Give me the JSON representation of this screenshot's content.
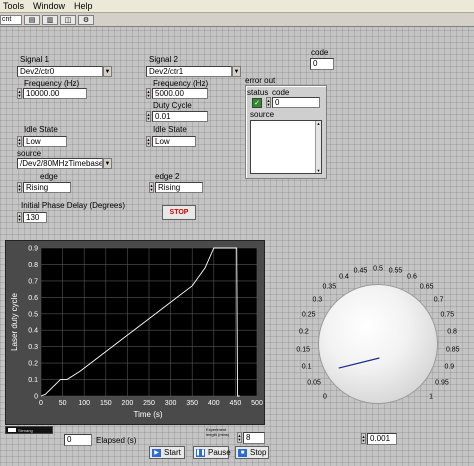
{
  "menu": {
    "items": [
      "Tools",
      "Window",
      "Help"
    ]
  },
  "toolbar": {
    "font_label": "cnt"
  },
  "signal1": {
    "title": "Signal 1",
    "channel": "Dev2/ctr0",
    "frequency_label": "Frequency (Hz)",
    "frequency": "10000.00",
    "idle_state_label": "Idle State",
    "idle_state": "Low",
    "source_label": "source",
    "source": "/Dev2/80MHzTimebase",
    "edge_label": "edge",
    "edge": "Rising",
    "phase_label": "Initial Phase Delay (Degrees)",
    "phase": "130"
  },
  "signal2": {
    "title": "Signal 2",
    "channel": "Dev2/ctr1",
    "frequency_label": "Frequency (Hz)",
    "frequency": "5000.00",
    "duty_cycle_label": "Duty Cycle",
    "duty_cycle": "0.01",
    "idle_state_label": "Idle State",
    "idle_state": "Low",
    "edge_label": "edge 2",
    "edge": "Rising"
  },
  "code_indicator": {
    "label": "code",
    "value": "0"
  },
  "error_out": {
    "title": "error out",
    "status_label": "status",
    "code_label": "code",
    "code": "0",
    "source_label": "source",
    "status_mark": "✓"
  },
  "stop_button": {
    "label": "STOP"
  },
  "chart_data": {
    "type": "line",
    "title": "",
    "xlabel": "Time (s)",
    "ylabel": "Laser duty cycle",
    "xlim": [
      0,
      500
    ],
    "ylim": [
      0,
      0.9
    ],
    "x_ticks": [
      "0",
      "50",
      "100",
      "150",
      "200",
      "250",
      "300",
      "350",
      "400",
      "450",
      "500"
    ],
    "y_ticks": [
      "0",
      "0.1",
      "0.2",
      "0.3",
      "0.4",
      "0.5",
      "0.6",
      "0.7",
      "0.8",
      "0.9"
    ],
    "grid": true,
    "series": [
      {
        "color": "#ffffff",
        "x": [
          0,
          10,
          45,
          60,
          90,
          120,
          150,
          200,
          250,
          300,
          350,
          380,
          400,
          430,
          445,
          453,
          455,
          460
        ],
        "y": [
          0,
          0.01,
          0.1,
          0.1,
          0.15,
          0.21,
          0.27,
          0.37,
          0.47,
          0.57,
          0.67,
          0.78,
          0.9,
          0.9,
          0.9,
          0.9,
          0,
          0
        ]
      }
    ]
  },
  "legend_chip": {
    "label": "Slenang"
  },
  "elapsed": {
    "label": "Elapsed (s)",
    "value": "0"
  },
  "experiment_length": {
    "label": "Experiment length (mins)",
    "value": "8"
  },
  "buttons": {
    "start": "Start",
    "pause": "Pause",
    "stop": "Stop"
  },
  "knob": {
    "scale": [
      "0",
      "0.05",
      "0.1",
      "0.15",
      "0.2",
      "0.25",
      "0.3",
      "0.35",
      "0.4",
      "0.45",
      "0.5",
      "0.55",
      "0.6",
      "0.65",
      "0.7",
      "0.75",
      "0.8",
      "0.85",
      "0.9",
      "0.95",
      "1"
    ],
    "value": 0.05,
    "readout": "0.001"
  }
}
